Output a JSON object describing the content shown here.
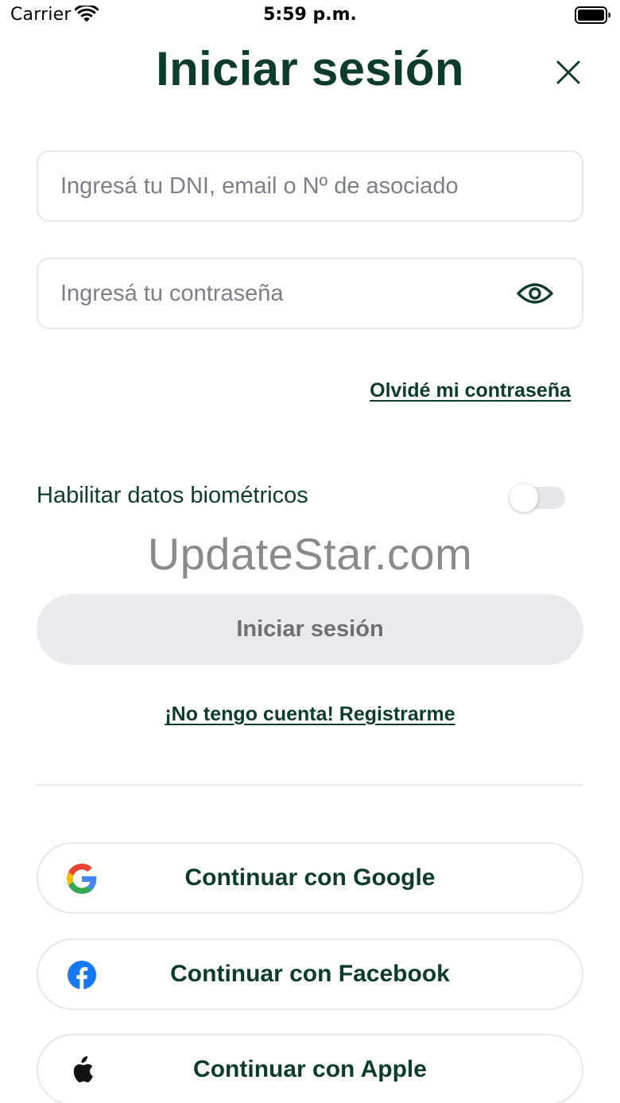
{
  "status_bar": {
    "carrier": "Carrier",
    "time": "5:59 p.m."
  },
  "header": {
    "title": "Iniciar sesión",
    "close_icon": "close-icon"
  },
  "form": {
    "id_placeholder": "Ingresá tu DNI, email o Nº de asociado",
    "id_value": "",
    "password_placeholder": "Ingresá tu contraseña",
    "password_value": "",
    "show_password_icon": "eye-icon",
    "forgot_password": "Olvidé mi contraseña",
    "biometric_label": "Habilitar datos biométricos",
    "biometric_enabled": false,
    "submit_label": "Iniciar sesión"
  },
  "watermark": "UpdateStar.com",
  "register_link": "¡No tengo cuenta! Registrarme",
  "social": {
    "google": {
      "label": "Continuar con Google",
      "icon": "google-icon"
    },
    "facebook": {
      "label": "Continuar con Facebook",
      "icon": "facebook-icon"
    },
    "apple": {
      "label": "Continuar con Apple",
      "icon": "apple-icon"
    }
  },
  "colors": {
    "brand": "#0d3b2c",
    "placeholder": "#7c7f88",
    "disabled_button": "#ebebef",
    "border": "#e7e8ec",
    "facebook": "#1877f2"
  }
}
